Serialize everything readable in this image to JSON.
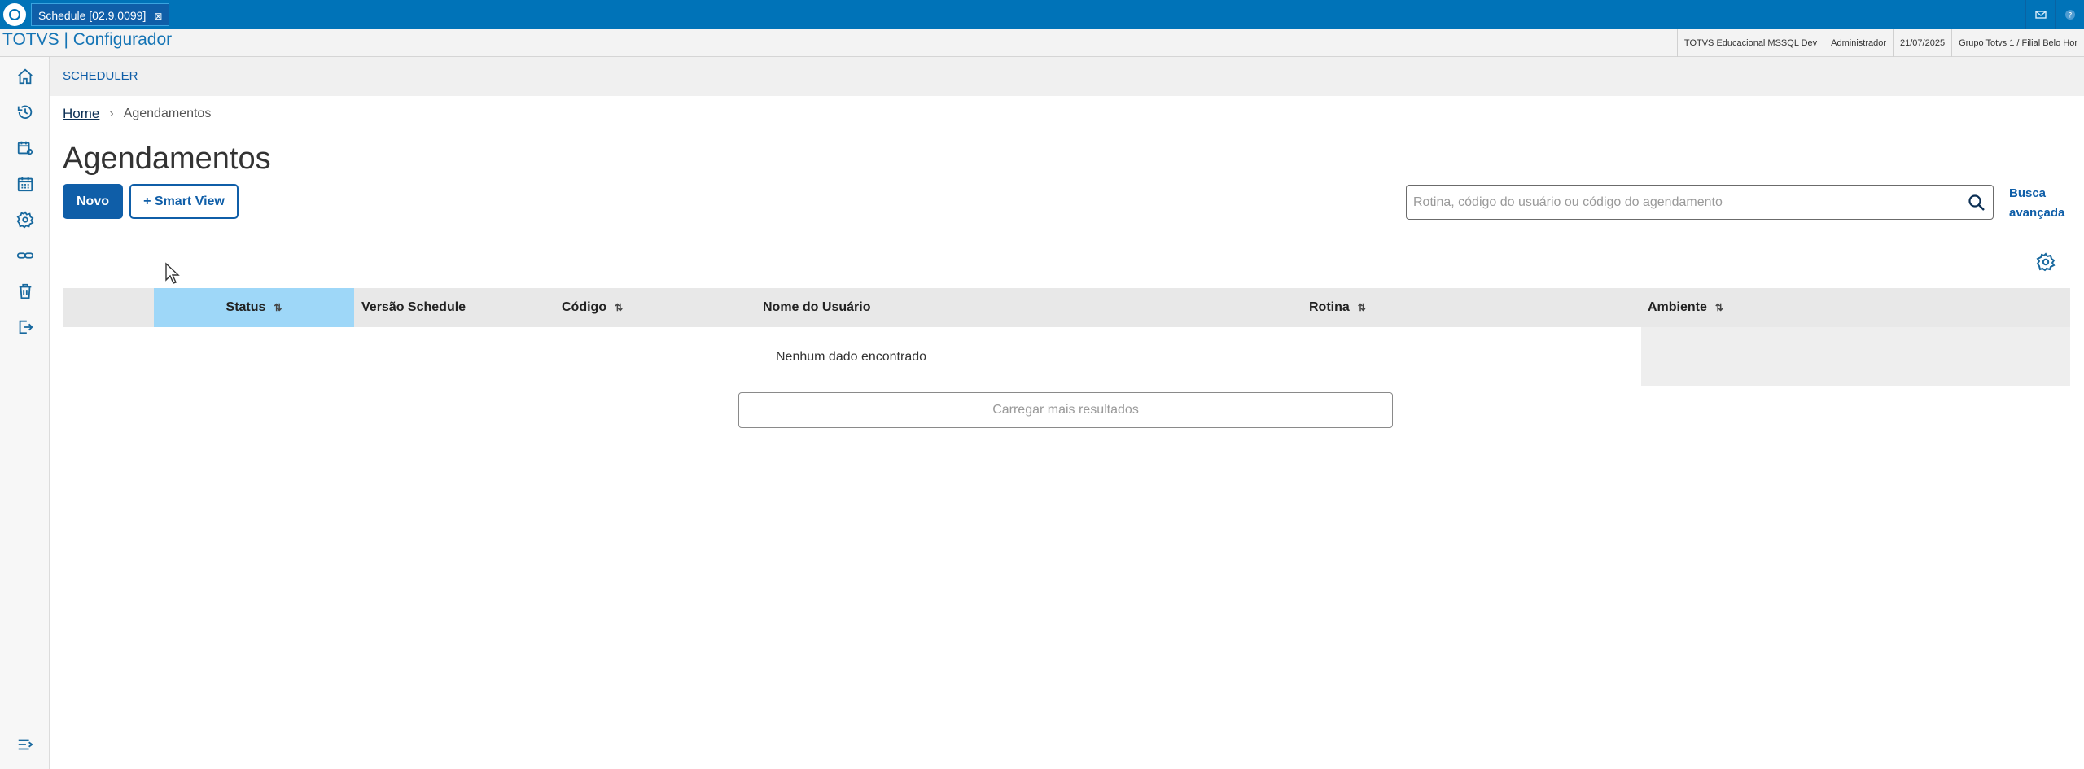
{
  "window": {
    "tab_title": "Schedule [02.9.0099]",
    "tab_close": "⊠"
  },
  "app": {
    "title": "TOTVS | Configurador",
    "context": [
      "TOTVS Educacional MSSQL Dev",
      "Administrador",
      "21/07/2025",
      "Grupo Totvs 1 / Filial Belo Hor"
    ]
  },
  "sidebar": {
    "items": [
      {
        "icon": "home-icon"
      },
      {
        "icon": "history-icon"
      },
      {
        "icon": "calendar-settings-icon"
      },
      {
        "icon": "calendar-icon"
      },
      {
        "icon": "gear-icon"
      },
      {
        "icon": "link-icon"
      },
      {
        "icon": "trash-icon"
      },
      {
        "icon": "logout-icon"
      }
    ],
    "collapse_icon": "menu-collapse-icon"
  },
  "section": {
    "title": "SCHEDULER"
  },
  "breadcrumb": {
    "home": "Home",
    "current": "Agendamentos"
  },
  "page": {
    "title": "Agendamentos"
  },
  "actions": {
    "novo": "Novo",
    "smart_view": "+ Smart View"
  },
  "search": {
    "placeholder": "Rotina, código do usuário ou código do agendamento",
    "value": "",
    "advanced_line1": "Busca",
    "advanced_line2": "avançada"
  },
  "table": {
    "columns": [
      {
        "label": "Status",
        "sortable": true
      },
      {
        "label": "Versão Schedule",
        "sortable": false
      },
      {
        "label": "Código",
        "sortable": true
      },
      {
        "label": "Nome do Usuário",
        "sortable": false
      },
      {
        "label": "Rotina",
        "sortable": true
      },
      {
        "label": "Ambiente",
        "sortable": true
      }
    ],
    "sort_glyph": "⇅",
    "empty_message": "Nenhum dado encontrado",
    "load_more": "Carregar mais resultados"
  },
  "colors": {
    "brand": "#0073b8",
    "primary": "#0f5ea8",
    "active_column": "#9ed7f8"
  }
}
